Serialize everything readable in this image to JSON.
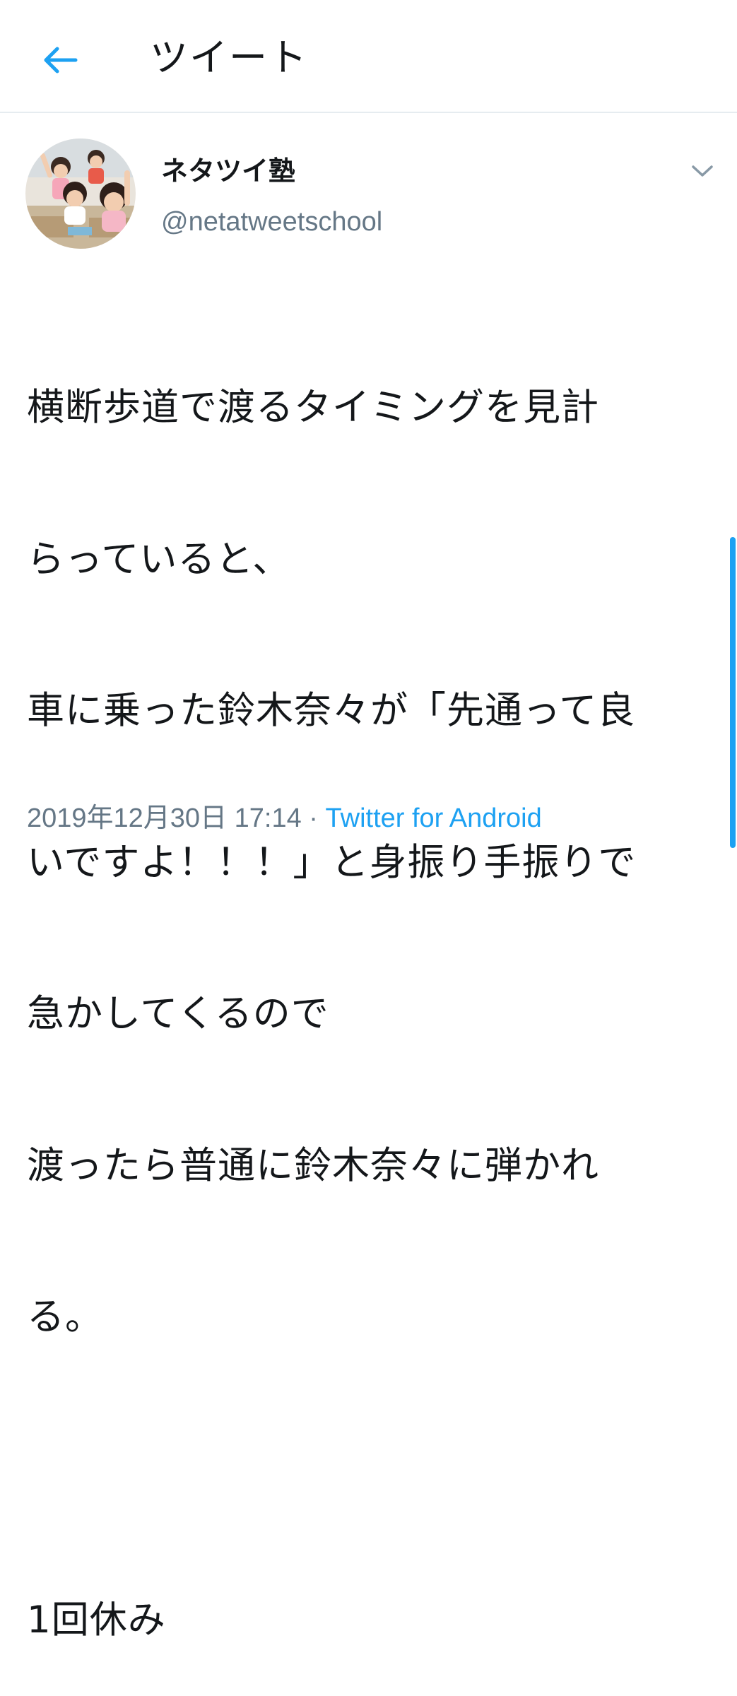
{
  "header": {
    "title": "ツイート",
    "back_icon": "arrow-left-icon",
    "accent_color": "#1da1f2"
  },
  "tweet": {
    "author": {
      "display_name": "ネタツイ塾",
      "handle": "@netatweetschool",
      "avatar_icon": "profile-photo-classroom"
    },
    "caret_icon": "chevron-down-icon",
    "lines": [
      "横断歩道で渡るタイミングを見計",
      "らっていると、",
      "車に乗った鈴木奈々が「先通って良",
      "いですよ！！！」と身振り手振りで",
      "急かしてくるので",
      "渡ったら普通に鈴木奈々に弾かれ",
      "る。",
      "",
      "1回休み"
    ],
    "timestamp": "2019年12月30日 17:14",
    "separator": " · ",
    "source": "Twitter for Android"
  }
}
